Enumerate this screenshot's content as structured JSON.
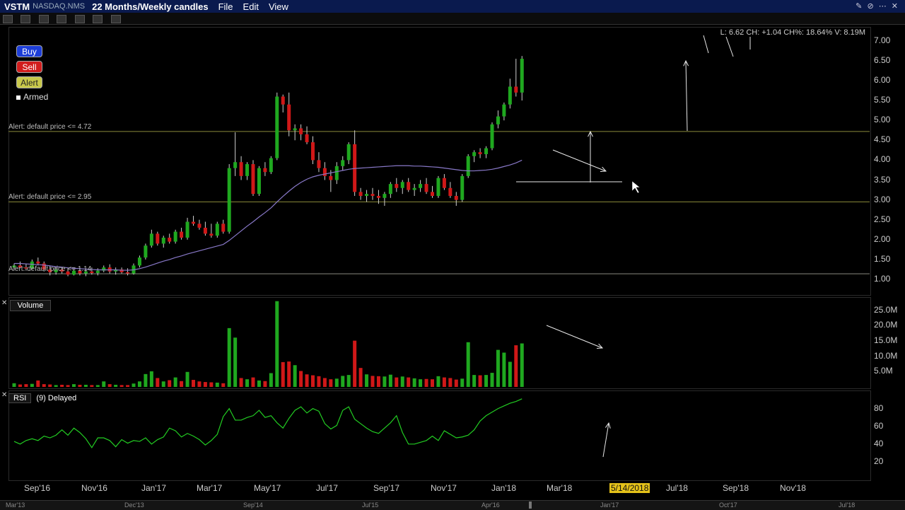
{
  "menubar": {
    "symbol": "VSTM",
    "exchange": "NASDAQ.NMS",
    "period": "22 Months/Weekly candles",
    "menus": [
      "File",
      "Edit",
      "View"
    ]
  },
  "order_buttons": {
    "buy": "Buy",
    "sell": "Sell",
    "alert": "Alert",
    "armed": "Armed"
  },
  "alerts": [
    {
      "label": "Alert: default price <= 4.72",
      "price": 4.72
    },
    {
      "label": "Alert: default price <= 2.95",
      "price": 2.95
    },
    {
      "label": "Alert: default price <= 1.14",
      "price": 1.14
    }
  ],
  "info_line": "L: 6.62 CH: +1.04 CH%: 18.64% V: 8.19M",
  "volume_title": "Volume",
  "rsi_title": "RSI",
  "rsi_params": "(9) Delayed",
  "colors": {
    "up": "#1fa81f",
    "down": "#d01818",
    "ma": "#8878c8",
    "rsi": "#22cc22",
    "alert_line": "#8a8a3a",
    "highlight": "#e5c21a"
  },
  "chart_data": {
    "type": "candlestick",
    "price_ylim": [
      0.8,
      7.3
    ],
    "price_ticks": [
      "7.00",
      "6.50",
      "6.00",
      "5.50",
      "5.00",
      "4.50",
      "4.00",
      "3.50",
      "3.00",
      "2.50",
      "2.00",
      "1.50",
      "1.00"
    ],
    "volume_ticks": [
      "25.0M",
      "20.0M",
      "15.0M",
      "10.0M",
      "5.0M"
    ],
    "volume_ylim": [
      0,
      28
    ],
    "rsi_ticks": [
      "80",
      "60",
      "40",
      "20"
    ],
    "rsi_ylim": [
      0,
      100
    ],
    "x_labels": [
      "Sep'16",
      "Nov'16",
      "Jan'17",
      "Mar'17",
      "May'17",
      "Jul'17",
      "Sep'17",
      "Nov'17",
      "Jan'18",
      "Mar'18",
      "5/14/2018",
      "Jul'18",
      "Sep'18",
      "Nov'18"
    ],
    "highlighted_x_label": "5/14/2018",
    "navigator_labels": [
      "Mar'13",
      "Dec'13",
      "Sep'14",
      "Jul'15",
      "Apr'16",
      "Jan'17",
      "Oct'17",
      "Jul'18"
    ],
    "ohlc": [
      [
        1.3,
        1.4,
        1.25,
        1.35
      ],
      [
        1.35,
        1.45,
        1.28,
        1.3
      ],
      [
        1.3,
        1.4,
        1.22,
        1.28
      ],
      [
        1.28,
        1.5,
        1.25,
        1.45
      ],
      [
        1.45,
        1.55,
        1.35,
        1.4
      ],
      [
        1.4,
        1.45,
        1.2,
        1.25
      ],
      [
        1.25,
        1.35,
        1.1,
        1.18
      ],
      [
        1.18,
        1.3,
        1.12,
        1.25
      ],
      [
        1.25,
        1.32,
        1.15,
        1.2
      ],
      [
        1.2,
        1.28,
        1.08,
        1.12
      ],
      [
        1.12,
        1.25,
        1.1,
        1.22
      ],
      [
        1.22,
        1.3,
        1.1,
        1.15
      ],
      [
        1.15,
        1.25,
        1.08,
        1.2
      ],
      [
        1.2,
        1.3,
        1.12,
        1.16
      ],
      [
        1.16,
        1.28,
        1.1,
        1.22
      ],
      [
        1.22,
        1.35,
        1.18,
        1.3
      ],
      [
        1.3,
        1.38,
        1.15,
        1.2
      ],
      [
        1.2,
        1.3,
        1.12,
        1.25
      ],
      [
        1.25,
        1.3,
        1.15,
        1.18
      ],
      [
        1.18,
        1.28,
        1.1,
        1.15
      ],
      [
        1.15,
        1.4,
        1.12,
        1.35
      ],
      [
        1.35,
        1.6,
        1.3,
        1.55
      ],
      [
        1.55,
        1.9,
        1.5,
        1.85
      ],
      [
        1.85,
        2.25,
        1.8,
        2.15
      ],
      [
        2.15,
        2.2,
        1.85,
        1.9
      ],
      [
        1.9,
        2.1,
        1.8,
        2.05
      ],
      [
        2.05,
        2.15,
        1.9,
        1.95
      ],
      [
        1.95,
        2.25,
        1.9,
        2.2
      ],
      [
        2.2,
        2.3,
        2.0,
        2.05
      ],
      [
        2.05,
        2.55,
        2.0,
        2.45
      ],
      [
        2.45,
        2.6,
        2.35,
        2.4
      ],
      [
        2.4,
        2.5,
        2.25,
        2.3
      ],
      [
        2.3,
        2.45,
        2.1,
        2.15
      ],
      [
        2.15,
        2.4,
        2.05,
        2.1
      ],
      [
        2.1,
        2.45,
        2.05,
        2.4
      ],
      [
        2.4,
        2.5,
        2.15,
        2.2
      ],
      [
        2.2,
        3.9,
        2.15,
        3.8
      ],
      [
        3.8,
        4.7,
        3.6,
        3.95
      ],
      [
        3.95,
        4.1,
        3.5,
        3.6
      ],
      [
        3.6,
        3.95,
        3.5,
        3.9
      ],
      [
        3.9,
        4.0,
        3.1,
        3.15
      ],
      [
        3.15,
        3.85,
        3.1,
        3.8
      ],
      [
        3.8,
        3.95,
        3.6,
        3.7
      ],
      [
        3.7,
        4.1,
        3.65,
        4.05
      ],
      [
        4.05,
        5.7,
        4.0,
        5.6
      ],
      [
        5.6,
        5.65,
        5.2,
        5.4
      ],
      [
        5.4,
        5.7,
        4.6,
        4.75
      ],
      [
        4.75,
        4.9,
        4.5,
        4.8
      ],
      [
        4.8,
        4.9,
        4.5,
        4.65
      ],
      [
        4.65,
        4.85,
        4.4,
        4.45
      ],
      [
        4.45,
        4.6,
        3.9,
        4.0
      ],
      [
        4.0,
        4.2,
        3.7,
        3.8
      ],
      [
        3.8,
        3.95,
        3.5,
        3.6
      ],
      [
        3.6,
        3.75,
        3.2,
        3.5
      ],
      [
        3.5,
        3.95,
        3.4,
        3.85
      ],
      [
        3.85,
        4.1,
        3.75,
        4.0
      ],
      [
        4.0,
        4.45,
        3.9,
        4.4
      ],
      [
        4.4,
        4.75,
        3.1,
        3.2
      ],
      [
        3.2,
        3.3,
        3.0,
        3.1
      ],
      [
        3.1,
        3.25,
        2.95,
        3.15
      ],
      [
        3.15,
        3.3,
        3.0,
        3.1
      ],
      [
        3.1,
        3.25,
        2.9,
        3.05
      ],
      [
        3.05,
        3.2,
        2.85,
        3.15
      ],
      [
        3.15,
        3.45,
        3.05,
        3.4
      ],
      [
        3.4,
        3.55,
        3.2,
        3.3
      ],
      [
        3.3,
        3.5,
        3.15,
        3.45
      ],
      [
        3.45,
        3.55,
        3.2,
        3.25
      ],
      [
        3.25,
        3.4,
        3.1,
        3.3
      ],
      [
        3.3,
        3.5,
        3.2,
        3.4
      ],
      [
        3.4,
        3.55,
        3.15,
        3.2
      ],
      [
        3.2,
        3.35,
        3.05,
        3.1
      ],
      [
        3.1,
        3.6,
        3.05,
        3.55
      ],
      [
        3.55,
        3.65,
        3.25,
        3.3
      ],
      [
        3.3,
        3.45,
        3.05,
        3.1
      ],
      [
        3.1,
        3.2,
        2.85,
        3.0
      ],
      [
        3.0,
        3.65,
        2.95,
        3.6
      ],
      [
        3.6,
        4.15,
        3.55,
        4.1
      ],
      [
        4.1,
        4.25,
        3.95,
        4.2
      ],
      [
        4.2,
        4.3,
        4.05,
        4.15
      ],
      [
        4.15,
        4.35,
        4.05,
        4.3
      ],
      [
        4.3,
        4.95,
        4.25,
        4.9
      ],
      [
        4.9,
        5.25,
        4.8,
        5.1
      ],
      [
        5.1,
        5.45,
        5.0,
        5.4
      ],
      [
        5.4,
        6.05,
        5.3,
        5.85
      ],
      [
        5.85,
        6.55,
        5.6,
        5.7
      ],
      [
        5.7,
        6.62,
        5.5,
        6.55
      ]
    ],
    "volume_millions": [
      1.2,
      0.8,
      0.9,
      1.0,
      2.1,
      0.9,
      0.8,
      0.6,
      0.7,
      0.6,
      0.9,
      0.7,
      0.7,
      0.6,
      0.6,
      1.8,
      0.9,
      0.7,
      0.6,
      0.6,
      1.1,
      1.8,
      4.2,
      5.1,
      2.9,
      1.8,
      2.2,
      3.1,
      1.9,
      4.9,
      2.3,
      1.8,
      1.6,
      1.5,
      1.4,
      1.2,
      19.2,
      16.1,
      2.9,
      2.5,
      3.1,
      2.1,
      1.9,
      4.5,
      28.0,
      8.1,
      8.3,
      7.1,
      5.2,
      4.1,
      3.8,
      3.5,
      2.9,
      2.5,
      2.7,
      3.6,
      3.9,
      15.1,
      6.2,
      4.1,
      3.6,
      3.5,
      3.4,
      4.0,
      3.1,
      3.4,
      3.1,
      2.8,
      2.5,
      2.6,
      2.5,
      3.5,
      3.1,
      2.9,
      2.4,
      2.7,
      14.6,
      3.9,
      3.8,
      3.9,
      4.6,
      12.1,
      11.2,
      8.2,
      13.6,
      14.2
    ],
    "moving_average": [
      1.4,
      1.4,
      1.39,
      1.38,
      1.37,
      1.36,
      1.34,
      1.32,
      1.31,
      1.29,
      1.28,
      1.27,
      1.26,
      1.25,
      1.24,
      1.24,
      1.24,
      1.24,
      1.23,
      1.23,
      1.24,
      1.27,
      1.31,
      1.36,
      1.41,
      1.46,
      1.5,
      1.55,
      1.59,
      1.64,
      1.68,
      1.72,
      1.76,
      1.8,
      1.84,
      1.88,
      1.98,
      2.1,
      2.22,
      2.34,
      2.45,
      2.57,
      2.68,
      2.8,
      2.95,
      3.09,
      3.22,
      3.34,
      3.44,
      3.52,
      3.58,
      3.62,
      3.65,
      3.68,
      3.71,
      3.74,
      3.77,
      3.79,
      3.8,
      3.81,
      3.82,
      3.83,
      3.84,
      3.85,
      3.86,
      3.86,
      3.86,
      3.85,
      3.85,
      3.84,
      3.83,
      3.82,
      3.8,
      3.78,
      3.76,
      3.74,
      3.73,
      3.73,
      3.74,
      3.75,
      3.77,
      3.8,
      3.84,
      3.88,
      3.93,
      4.0
    ],
    "rsi": [
      43,
      40,
      44,
      46,
      44,
      49,
      47,
      50,
      56,
      50,
      58,
      53,
      46,
      36,
      47,
      47,
      44,
      37,
      45,
      41,
      44,
      43,
      47,
      40,
      45,
      48,
      58,
      55,
      48,
      52,
      49,
      45,
      39,
      44,
      51,
      71,
      80,
      67,
      67,
      70,
      72,
      78,
      70,
      72,
      64,
      58,
      69,
      78,
      82,
      75,
      80,
      77,
      63,
      57,
      61,
      78,
      82,
      68,
      63,
      58,
      54,
      52,
      58,
      64,
      72,
      53,
      40,
      40,
      42,
      44,
      49,
      44,
      55,
      51,
      47,
      48,
      50,
      56,
      66,
      72,
      76,
      80,
      83,
      86,
      88,
      91
    ]
  }
}
